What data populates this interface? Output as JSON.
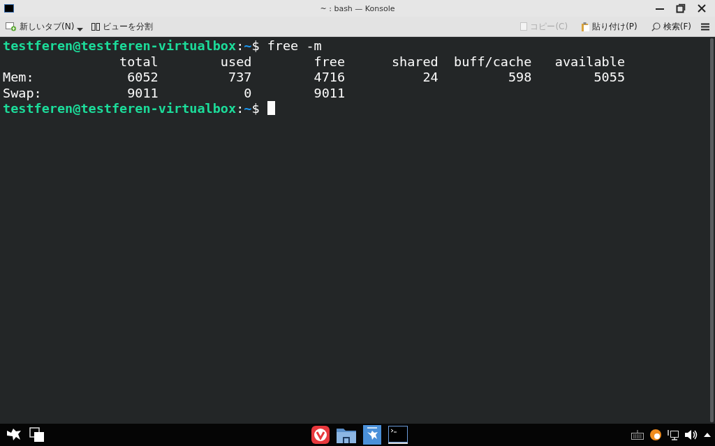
{
  "window": {
    "title": "~ : bash — Konsole"
  },
  "toolbar": {
    "left": [
      {
        "kind": "new-tab",
        "label": "新しいタブ(N)",
        "disabled": false
      },
      {
        "kind": "split",
        "label": "ビューを分割",
        "disabled": false
      }
    ],
    "right": [
      {
        "kind": "copy",
        "label": "コピー(C)",
        "disabled": true
      },
      {
        "kind": "paste",
        "label": "貼り付け(P)",
        "disabled": false
      },
      {
        "kind": "search",
        "label": "検索(F)",
        "disabled": false
      }
    ]
  },
  "terminal": {
    "lines": [
      {
        "kind": "prompt",
        "user_host": "testferen@testferen-virtualbox",
        "separator": ":",
        "path": "~",
        "symbol": "$",
        "command": "free -m"
      },
      {
        "kind": "output",
        "text": "               total        used        free      shared  buff/cache   available"
      },
      {
        "kind": "output",
        "text": "Mem:            6052         737        4716          24         598        5055"
      },
      {
        "kind": "output",
        "text": "Swap:           9011           0        9011"
      },
      {
        "kind": "prompt",
        "user_host": "testferen@testferen-virtualbox",
        "separator": ":",
        "path": "~",
        "symbol": "$",
        "cursor": true
      }
    ]
  },
  "taskbar": {
    "apps": [
      {
        "kind": "browser",
        "selected": false
      },
      {
        "kind": "files",
        "selected": false
      },
      {
        "kind": "store",
        "selected": false
      },
      {
        "kind": "terminal",
        "selected": true
      }
    ]
  }
}
